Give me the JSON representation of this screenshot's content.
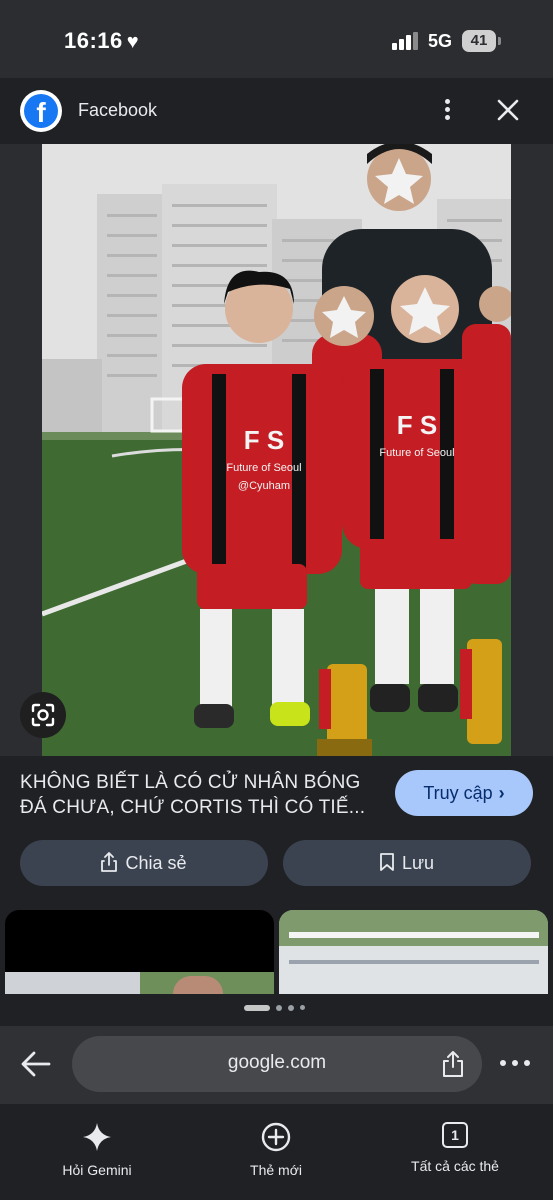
{
  "status_bar": {
    "time": "16:16",
    "heart_icon": "heart-icon",
    "network": "5G",
    "battery": "41"
  },
  "source": {
    "logo_letter": "f",
    "name": "Facebook",
    "icons": [
      "facebook-logo-icon",
      "more-vert-icon",
      "close-icon"
    ]
  },
  "image": {
    "jersey_text_1": "F S",
    "jersey_text_2": "Future of Seoul",
    "jersey_handle": "@Cyuham",
    "lens_icon": "google-lens-icon"
  },
  "result": {
    "caption": "KHÔNG BIẾT LÀ CÓ CỬ NHÂN BÓNG ĐÁ CHƯA, CHỨ CORTIS THÌ CÓ TIẾ...",
    "visit_label": "Truy cập",
    "visit_chevron": "›",
    "share_label": "Chia sẻ",
    "save_label": "Lưu"
  },
  "browser": {
    "url": "google.com"
  },
  "bottom_nav": {
    "gemini_label": "Hỏi Gemini",
    "new_tab_label": "Thẻ mới",
    "tabs_label": "Tất cả các thẻ",
    "tabs_count": "1"
  },
  "colors": {
    "background": "#202124",
    "accent_button": "#a8c7fa",
    "pill_button": "#3c4350",
    "facebook_blue": "#1877f2"
  }
}
